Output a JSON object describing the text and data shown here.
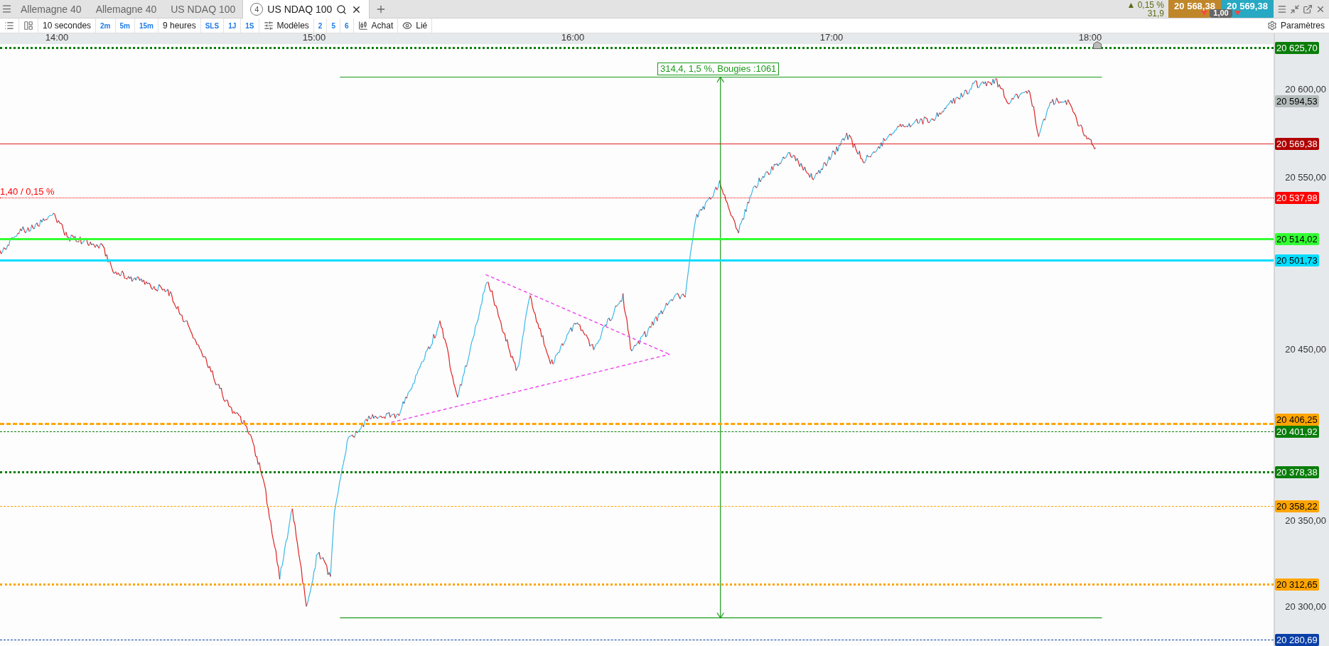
{
  "tabs": [
    {
      "label": "Allemagne 40",
      "selected": false
    },
    {
      "label": "Allemagne 40",
      "selected": false
    },
    {
      "label": "US NDAQ 100",
      "selected": false
    },
    {
      "label": "US NDAQ 100",
      "badge": "4",
      "selected": true
    }
  ],
  "quote": {
    "change": "▲ 0,15 %",
    "points": "31,9",
    "sell": "20 568,38",
    "buy": "20 569,38",
    "spread": "1,00"
  },
  "toolbar": {
    "timeframe": "10 secondes",
    "intervals_1": [
      "2m",
      "5m",
      "15m"
    ],
    "period": "9 heures",
    "intervals_2": [
      "SLS",
      "1J",
      "1S"
    ],
    "templates": "Modèles",
    "counts": [
      "2",
      "5",
      "6"
    ],
    "order": "Achat",
    "link": "Lié",
    "settings": "Paramètres"
  },
  "time_axis": [
    "14:00",
    "15:00",
    "16:00",
    "17:00",
    "18:00"
  ],
  "price_ticks": [
    "20 600,00",
    "20 550,00",
    "20 450,00",
    "20 350,00",
    "20 300,00"
  ],
  "price_lines": [
    {
      "value": "20 625,70",
      "color": "#0a7d0a",
      "kind": "dotted",
      "thick": true
    },
    {
      "value": "20 594,53",
      "color": "#b5bcbc",
      "kind": "none"
    },
    {
      "value": "20 569,38",
      "color": "#b00000",
      "kind": "solid",
      "thick": false
    },
    {
      "value": "20 537,98",
      "color": "#ff0000",
      "kind": "dotted",
      "thick": false,
      "label": "1,40 / 0,15 %"
    },
    {
      "value": "20 514,02",
      "color": "#33ff33",
      "kind": "solid",
      "thick": true
    },
    {
      "value": "20 501,73",
      "color": "#00ddff",
      "kind": "solid",
      "thick": true
    },
    {
      "value": "20 406,25",
      "color": "#ffa500",
      "kind": "dashed",
      "thick": true
    },
    {
      "value": "20 401,92",
      "color": "#0a7d0a",
      "kind": "dashed",
      "thick": false
    },
    {
      "value": "20 378,38",
      "color": "#0a7d0a",
      "kind": "dotted",
      "thick": true
    },
    {
      "value": "20 358,22",
      "color": "#ffa500",
      "kind": "dashed",
      "thick": false
    },
    {
      "value": "20 312,65",
      "color": "#ffa500",
      "kind": "dotted",
      "thick": true
    },
    {
      "value": "20 280,69",
      "color": "#0a3fa8",
      "kind": "dashed",
      "thick": false
    }
  ],
  "measurement": {
    "label": "314,4, 1,5 %, Bougies :1061"
  }
}
